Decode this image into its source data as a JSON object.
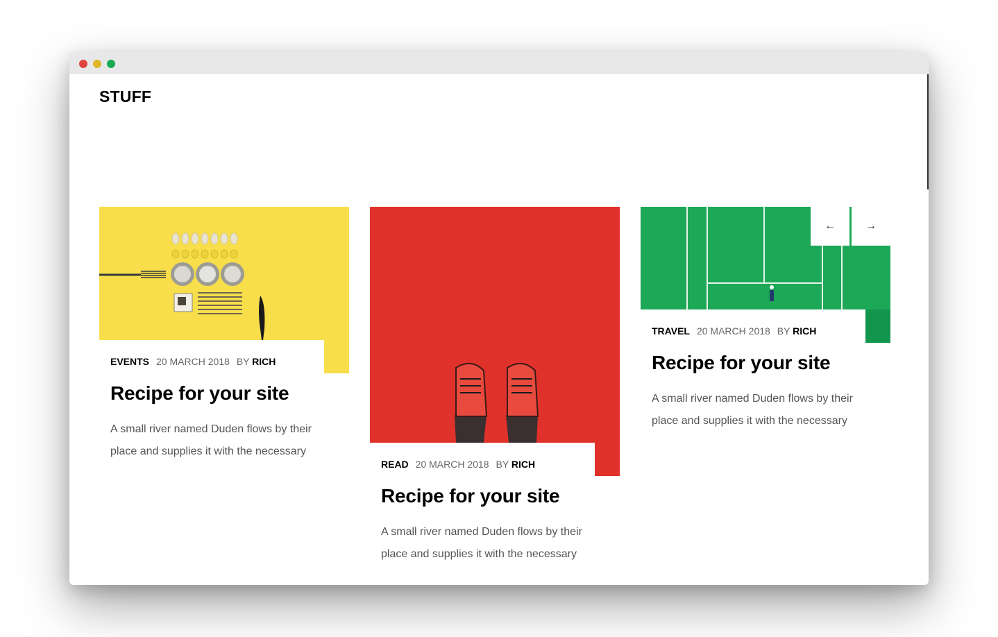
{
  "site": {
    "logo": "STUFF"
  },
  "window": {
    "controls": [
      "close",
      "minimize",
      "maximize"
    ]
  },
  "slider": {
    "prev_icon": "arrow-left-icon",
    "next_icon": "arrow-right-icon",
    "prev_glyph": "←",
    "next_glyph": "→"
  },
  "cards": [
    {
      "category": "EVENTS",
      "date": "20 MARCH 2018",
      "by": "BY",
      "author": "RICH",
      "title": "Recipe for your site",
      "excerpt": "A small river named Duden flows by their place and supplies it with the necessary",
      "image_color": "#f7de4a"
    },
    {
      "category": "READ",
      "date": "20 MARCH 2018",
      "by": "BY",
      "author": "RICH",
      "title": "Recipe for your site",
      "excerpt": "A small river named Duden flows by their place and supplies it with the necessary",
      "image_color": "#e0322a"
    },
    {
      "category": "TRAVEL",
      "date": "20 MARCH 2018",
      "by": "BY",
      "author": "RICH",
      "title": "Recipe for your site",
      "excerpt": "A small river named Duden flows by their place and supplies it with the necessary",
      "image_color": "#12964e"
    }
  ]
}
